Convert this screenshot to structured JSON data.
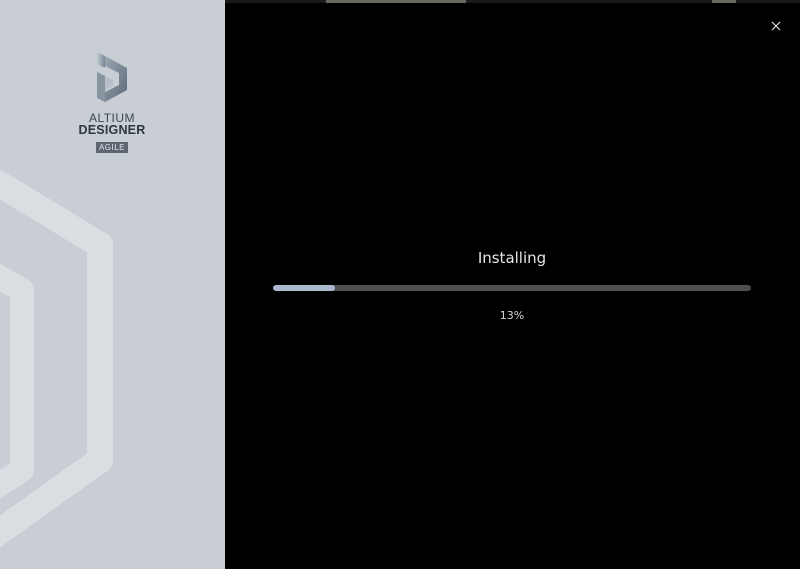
{
  "window": {
    "close_icon": "close-icon"
  },
  "brand": {
    "line1": "ALTIUM",
    "line2": "DESIGNER",
    "badge": "AGILE",
    "mark_icon": "altium-logo-icon",
    "panel_color": "#c9ced4"
  },
  "install": {
    "status": "Installing",
    "progress_fraction": 0.13,
    "progress_label": "13%",
    "fill_color": "#a9b8cb",
    "track_color": "#4e4e4e"
  }
}
